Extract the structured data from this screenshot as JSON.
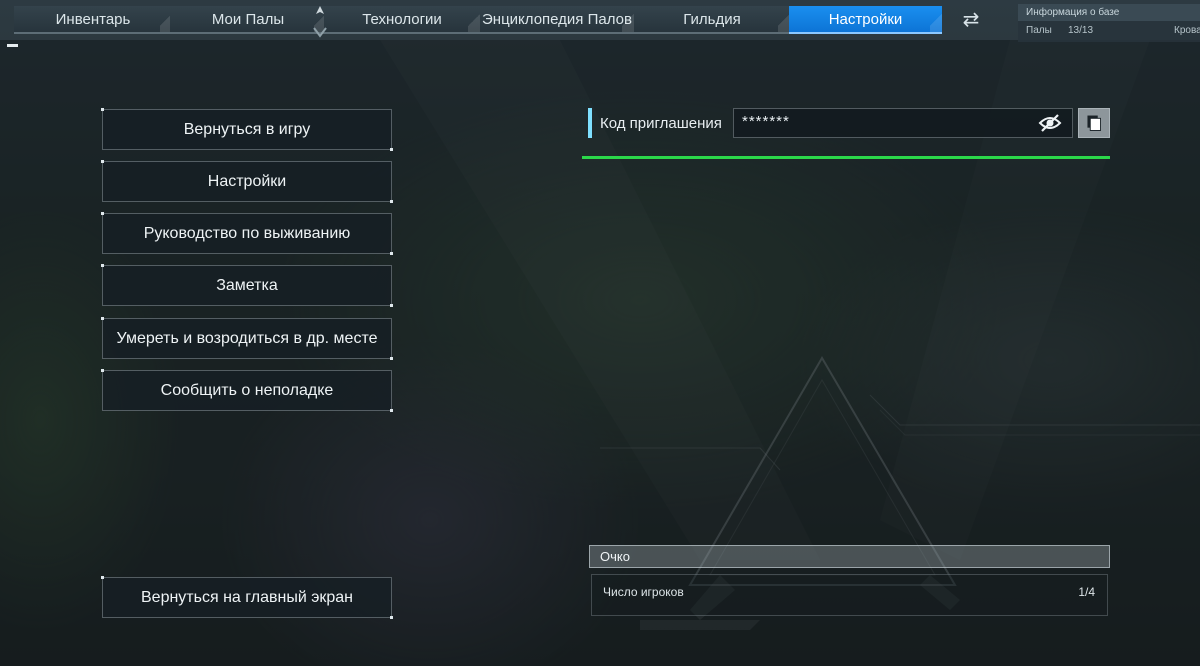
{
  "tabs": [
    {
      "label": "Инвентарь",
      "active": false
    },
    {
      "label": "Мои Палы",
      "active": false
    },
    {
      "label": "Технологии",
      "active": false
    },
    {
      "label": "Энциклопедия Палов",
      "active": false
    },
    {
      "label": "Гильдия",
      "active": false
    },
    {
      "label": "Настройки",
      "active": true
    }
  ],
  "swap_icon": "swap-arrows-icon",
  "base_info": {
    "title": "Информация о базе",
    "pals_label": "Палы",
    "pals_count": "13/13",
    "bed_label": "Крова"
  },
  "menu": {
    "items": [
      "Вернуться в игру",
      "Настройки",
      "Руководство по выживанию",
      "Заметка",
      "Умереть и возродиться в др. месте",
      "Сообщить о неполадке"
    ],
    "main_screen": "Вернуться на главный экран"
  },
  "invite": {
    "label": "Код приглашения",
    "value": "*******",
    "visibility_icon": "eye-off-icon",
    "copy_icon": "copy-icon"
  },
  "players": {
    "header": "Очко",
    "label": "Число игроков",
    "count": "1/4"
  },
  "colors": {
    "active_tab": "#1a8ff0",
    "accent_line": "#2bd84a",
    "invite_bar": "#7fe0ff"
  }
}
